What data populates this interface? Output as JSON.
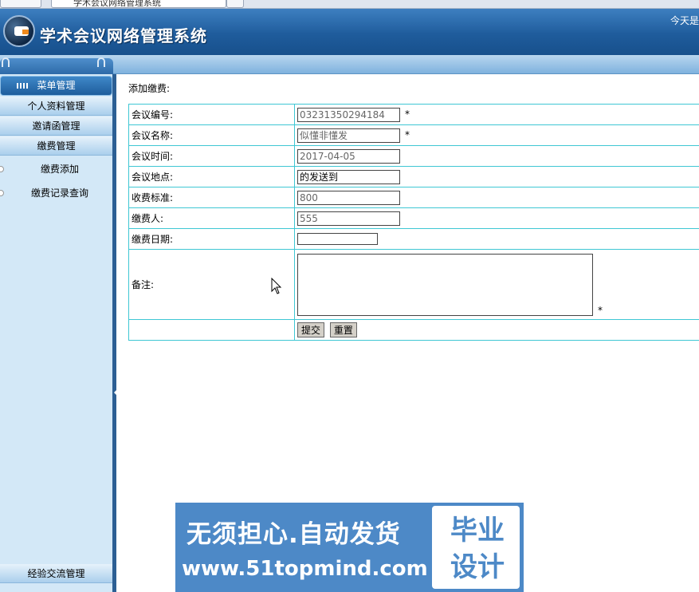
{
  "browser": {
    "tab_title": "学术会议网络管理系统"
  },
  "header": {
    "app_title": "学术会议网络管理系统",
    "today_label": "今天是"
  },
  "sidebar": {
    "menu_title": "菜单管理",
    "categories": [
      {
        "label": "个人资料管理"
      },
      {
        "label": "邀请函管理"
      },
      {
        "label": "缴费管理"
      }
    ],
    "sub_items": [
      {
        "label": "缴费添加"
      },
      {
        "label": "缴费记录查询"
      }
    ],
    "bottom_category": "经验交流管理"
  },
  "main": {
    "heading": "添加缴费:",
    "fields": [
      {
        "label": "会议编号:",
        "value": "03231350294184",
        "required": "*"
      },
      {
        "label": "会议名称:",
        "value": "似懂非懂发",
        "required": "*"
      },
      {
        "label": "会议时间:",
        "value": "2017-04-05"
      },
      {
        "label": "会议地点:",
        "value": "的发送到"
      },
      {
        "label": "收费标准:",
        "value": "800"
      },
      {
        "label": "缴费人:",
        "value": "555"
      },
      {
        "label": "缴费日期:",
        "value": ""
      },
      {
        "label": "备注:",
        "value": "",
        "required": "*"
      }
    ],
    "buttons": {
      "submit": "提交",
      "reset": "重置"
    }
  },
  "ad": {
    "line1": "无须担心.自动发货",
    "line2": "www.51topmind.com",
    "box_text": "毕业设计"
  }
}
